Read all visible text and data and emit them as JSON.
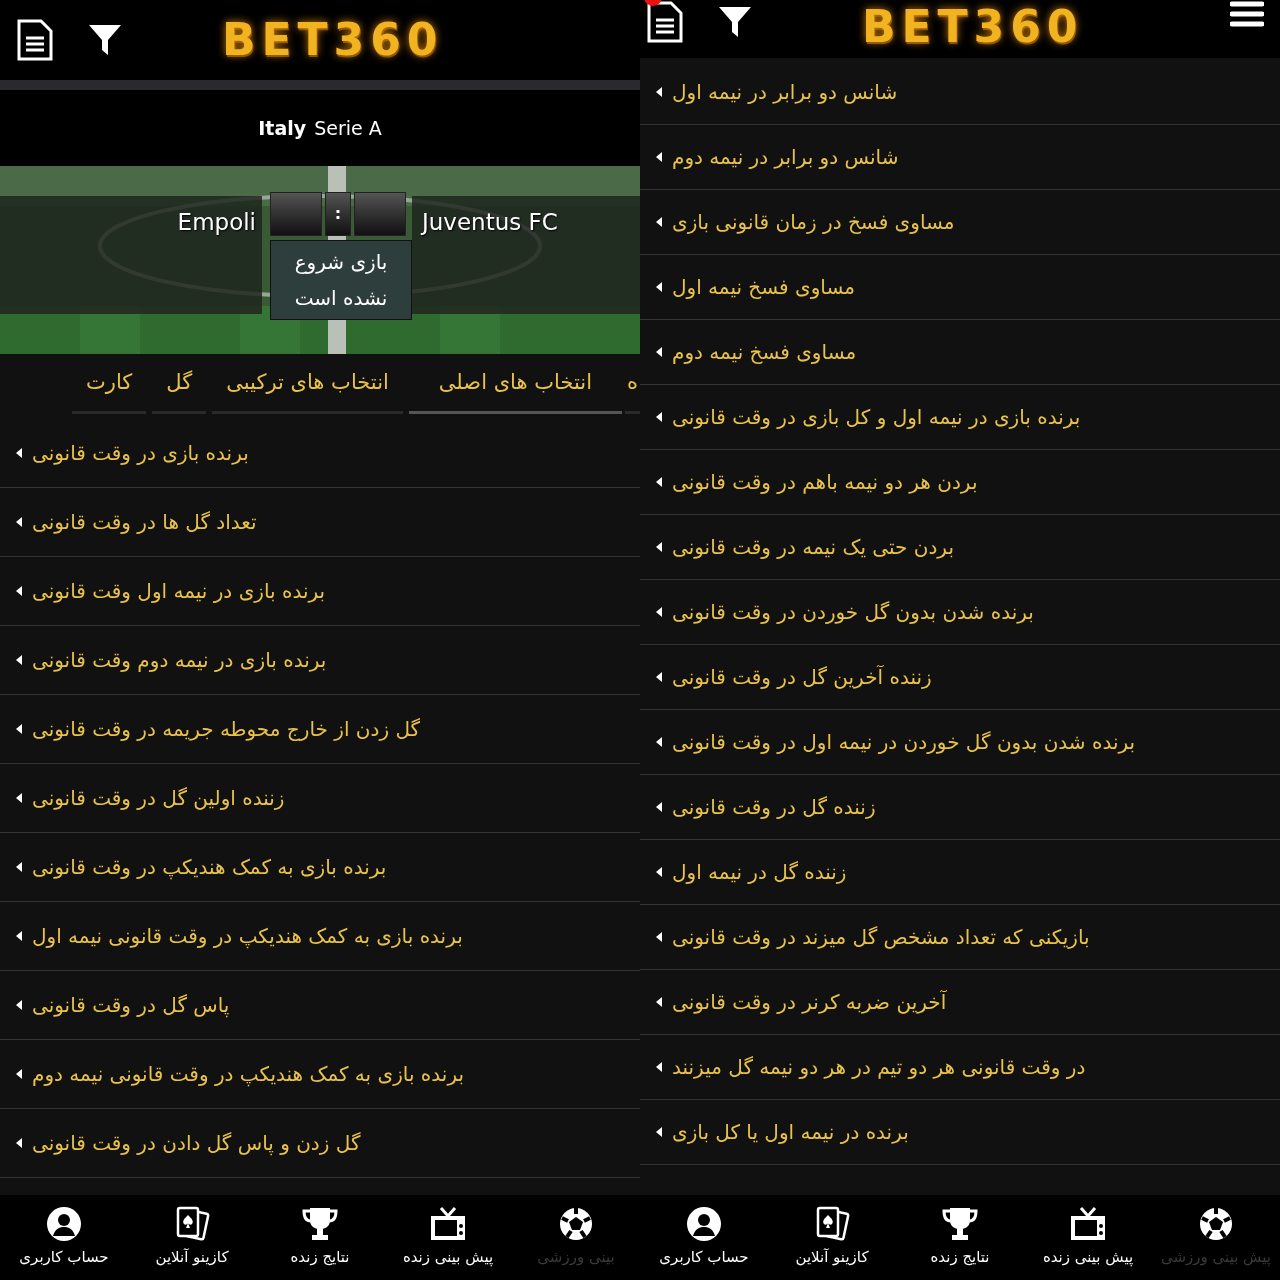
{
  "left_screen": {
    "header": {
      "logo": "BET360"
    },
    "league": {
      "country": "Italy",
      "name": "Serie A"
    },
    "match": {
      "home": "Juventus FC",
      "away": "Empoli",
      "separator": ":",
      "status": "بازی شروع نشده است"
    },
    "tabs": [
      {
        "label": "ه",
        "selected": false
      },
      {
        "label": "انتخاب های اصلی",
        "selected": true
      },
      {
        "label": "انتخاب های ترکیبی",
        "selected": false
      },
      {
        "label": "گل",
        "selected": false
      },
      {
        "label": "کارت",
        "selected": false
      }
    ],
    "markets": [
      "برنده بازی در وقت قانونی",
      "تعداد گل ها در وقت قانونی",
      "برنده بازی در نیمه اول وقت قانونی",
      "برنده بازی در نیمه دوم وقت قانونی",
      "گل زدن از خارج محوطه جریمه در وقت قانونی",
      "زننده اولین گل در وقت قانونی",
      "برنده بازی به کمک هندیکپ در وقت قانونی",
      "برنده بازی به کمک هندیکپ در وقت قانونی نیمه اول",
      "پاس گل در وقت قانونی",
      "برنده بازی به کمک هندیکپ در وقت قانونی نیمه دوم",
      "گل زدن و پاس گل دادن در وقت قانونی"
    ],
    "nav": [
      {
        "kind": "ball",
        "label": "بینی ورزشی",
        "selected": true
      },
      {
        "kind": "tv",
        "label": "پیش بینی زنده",
        "selected": false
      },
      {
        "kind": "trophy",
        "label": "نتایج زنده",
        "selected": false
      },
      {
        "kind": "cards",
        "label": "کازینو آنلاین",
        "selected": false
      },
      {
        "kind": "user",
        "label": "حساب کاربری",
        "selected": false
      }
    ]
  },
  "right_screen": {
    "header": {
      "logo": "BET360",
      "badge": true
    },
    "markets": [
      "شانس دو برابر در نیمه اول",
      "شانس دو برابر در نیمه دوم",
      "مساوی فسخ در زمان قانونی بازی",
      "مساوی فسخ نیمه اول",
      "مساوی فسخ نیمه دوم",
      "برنده بازی در نیمه اول و کل بازی در وقت قانونی",
      "بردن هر دو نیمه باهم در وقت قانونی",
      "بردن حتی یک نیمه در وقت قانونی",
      "برنده شدن بدون گل خوردن در وقت قانونی",
      "زننده آخرین گل در وقت قانونی",
      "برنده شدن بدون گل خوردن در نیمه اول در وقت قانونی",
      "زننده گل در وقت قانونی",
      "زننده گل در نیمه اول",
      "بازیکنی که تعداد مشخص گل میزند در وقت قانونی",
      "آخرین ضربه کرنر در وقت قانونی",
      "در وقت قانونی هر دو تیم در هر دو نیمه گل میزنند",
      "برنده در نیمه اول یا کل بازی"
    ],
    "nav": [
      {
        "kind": "ball",
        "label": "پیش بینی ورزشی",
        "selected": true
      },
      {
        "kind": "tv",
        "label": "پیش بینی زنده",
        "selected": false
      },
      {
        "kind": "trophy",
        "label": "نتایج زنده",
        "selected": false
      },
      {
        "kind": "cards",
        "label": "کازینو آنلاین",
        "selected": false
      },
      {
        "kind": "user",
        "label": "حساب کاربری",
        "selected": false
      }
    ]
  }
}
